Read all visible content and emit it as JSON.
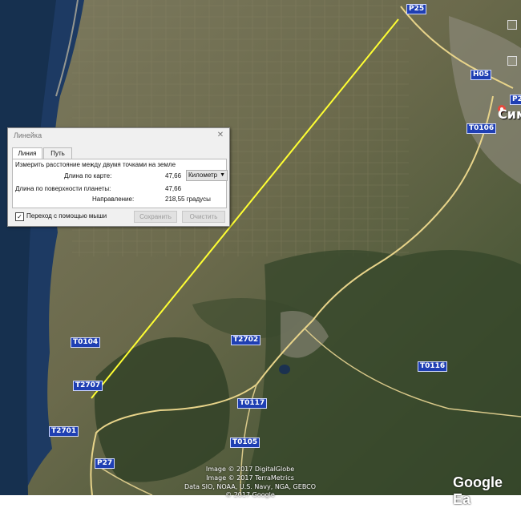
{
  "map": {
    "city_label": "Сим",
    "road_shields": [
      "P25",
      "H05",
      "P2",
      "T0106",
      "T0104",
      "T2702",
      "T0116",
      "T2707",
      "T0117",
      "T2701",
      "T0105",
      "P27"
    ],
    "attribution": [
      "Image © 2017 DigitalGlobe",
      "Image © 2017 TerraMetrics",
      "Data SIO, NOAA, U.S. Navy, NGA, GEBCO",
      "© 2017 Google"
    ],
    "logo": "Google Ea",
    "colors": {
      "measure_line": "#ffff33",
      "sea": "#1d3a63",
      "road_shield": "#1f3fb3",
      "pin": "#e64a3c"
    }
  },
  "ruler": {
    "title": "Линейка",
    "tabs": [
      "Линия",
      "Путь"
    ],
    "active_tab": "Линия",
    "description": "Измерить расстояние между двумя точками на земле",
    "map_length_label": "Длина по карте:",
    "map_length_value": "47,66",
    "unit": "Километр",
    "surface_length_label": "Длина по поверхности планеты:",
    "surface_length_value": "47,66",
    "heading_label": "Направление:",
    "heading_value": "218,55 градусы",
    "mouse_nav_label": "Переход с помощью мыши",
    "mouse_nav_checked": true,
    "save_label": "Сохранить",
    "clear_label": "Очистить"
  }
}
